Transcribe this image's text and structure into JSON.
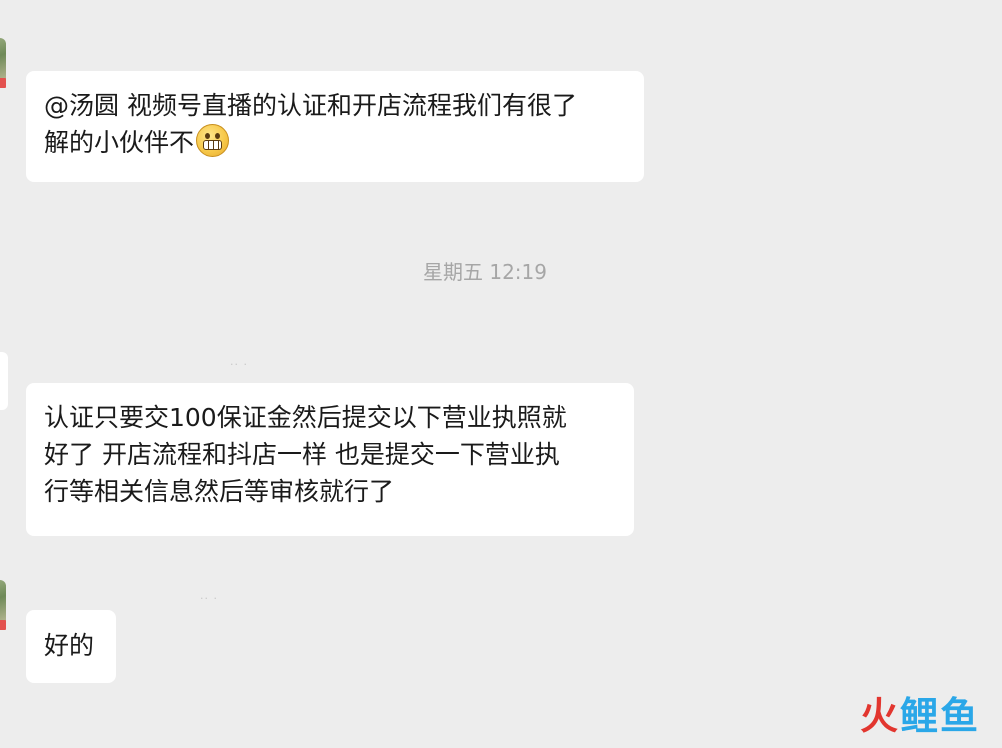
{
  "messages": [
    {
      "text_line1": "@汤圆 视频号直播的认证和开店流程我们有很了",
      "text_line2": "解的小伙伴不",
      "emoji": "grimacing-face-emoji"
    },
    {
      "lines": [
        "认证只要交100保证金然后提交以下营业执照就",
        "好了 开店流程和抖店一样  也是提交一下营业执",
        "行等相关信息然后等审核就行了"
      ]
    },
    {
      "text": "好的"
    }
  ],
  "timestamp": "星期五 12:19",
  "watermark": {
    "part1": "火",
    "part2": "鲤",
    "part3": "鱼",
    "color_primary": "#e2362f",
    "color_secondary": "#2aa7e8"
  },
  "colors": {
    "background": "#ededed",
    "bubble": "#ffffff",
    "timestamp_text": "#a6a6a6"
  }
}
